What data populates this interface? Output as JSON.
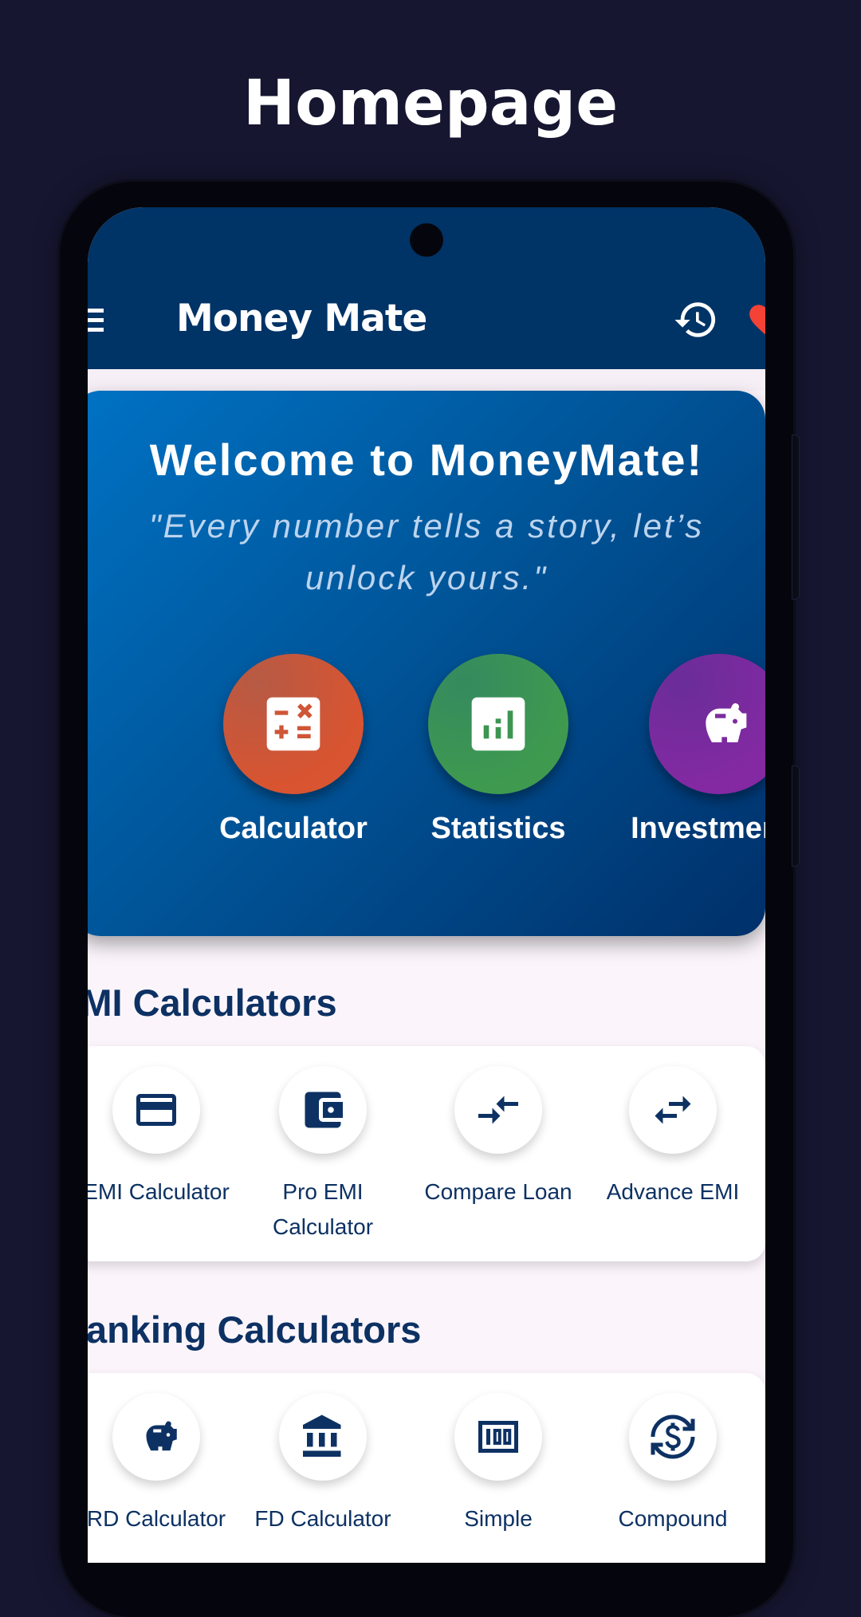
{
  "page": {
    "title": "Homepage"
  },
  "appbar": {
    "title": "Money Mate",
    "menu_icon": "hamburger-menu-icon",
    "history_icon": "history-icon",
    "favorite_icon": "heart-icon"
  },
  "welcome": {
    "title": "Welcome to MoneyMate!",
    "quote_line1": "\"Every number tells a story, let’s",
    "quote_line2": "unlock yours.\"",
    "actions": [
      {
        "label": "Calculator",
        "icon": "calculator-icon",
        "color": "#d0553a"
      },
      {
        "label": "Statistics",
        "icon": "bar-chart-icon",
        "color": "#3a9155"
      },
      {
        "label": "Investments",
        "icon": "piggy-bank-icon",
        "color": "#7b2d9e"
      }
    ]
  },
  "emi_section": {
    "title": "EMI Calculators",
    "items": [
      {
        "label": "EMI Calculator",
        "icon": "credit-card-icon"
      },
      {
        "label_line1": "Pro EMI",
        "label_line2": "Calculator",
        "icon": "wallet-icon"
      },
      {
        "label": "Compare Loan",
        "icon": "compare-arrows-icon"
      },
      {
        "label": "Advance EMI",
        "icon": "swap-arrows-icon"
      }
    ]
  },
  "banking_section": {
    "title": "Banking Calculators",
    "items": [
      {
        "label": "RD Calculator",
        "icon": "piggy-bank-icon"
      },
      {
        "label": "FD Calculator",
        "icon": "bank-icon"
      },
      {
        "label": "Simple",
        "icon": "hundred-note-icon"
      },
      {
        "label": "Compound",
        "icon": "currency-exchange-icon"
      }
    ]
  },
  "colors": {
    "background": "#161631",
    "appbar": "#003366",
    "text_primary": "#0d3163",
    "card_gradient_start": "#0072c4",
    "card_gradient_end": "#00306a"
  }
}
